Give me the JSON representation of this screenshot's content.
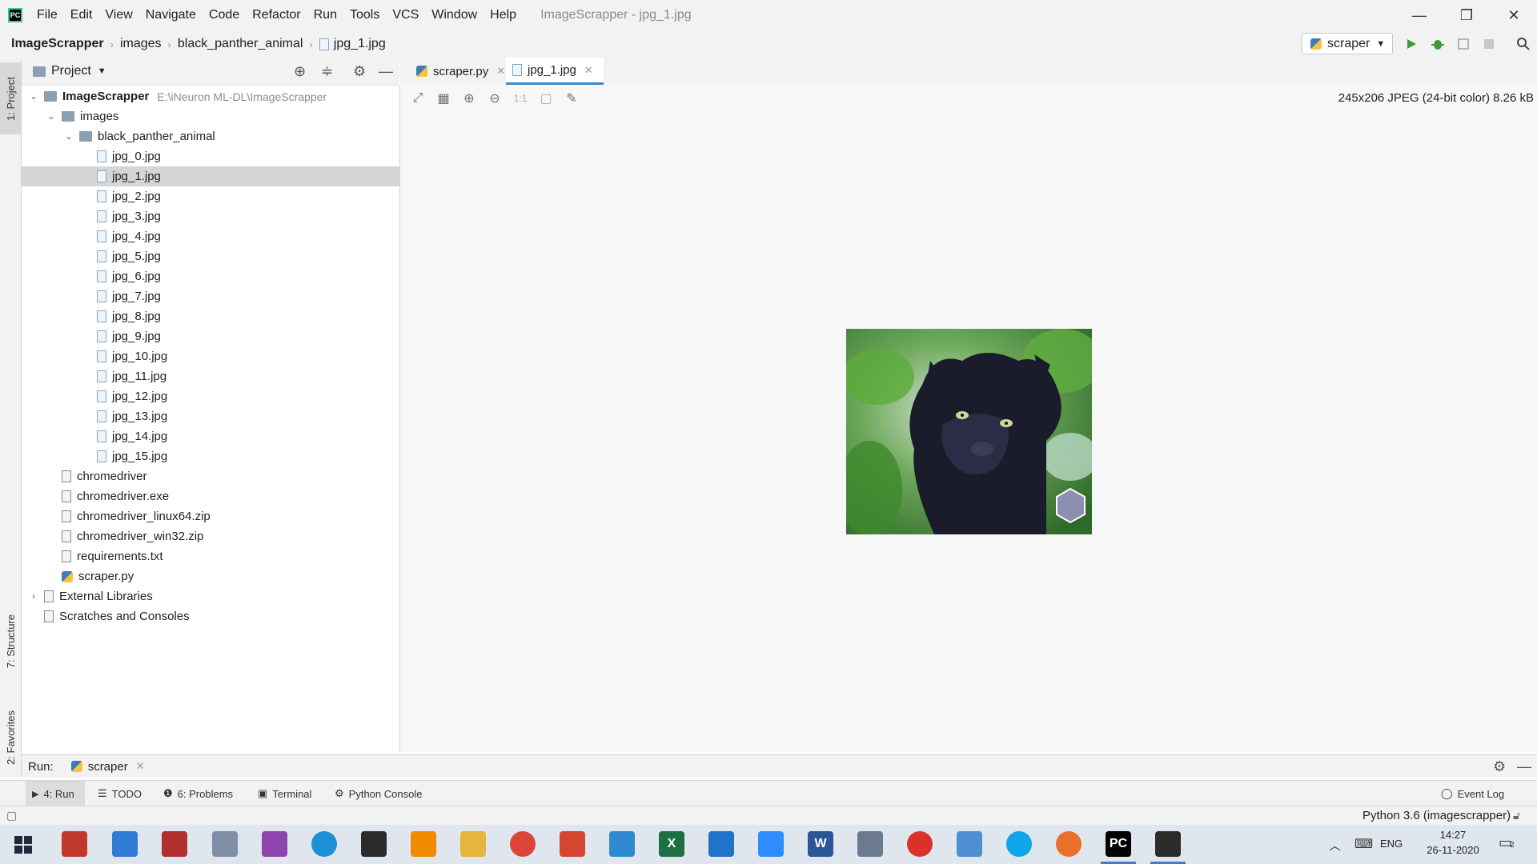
{
  "menu": {
    "logo": "PC",
    "items": [
      "File",
      "Edit",
      "View",
      "Navigate",
      "Code",
      "Refactor",
      "Run",
      "Tools",
      "VCS",
      "Window",
      "Help"
    ],
    "window_title": "ImageScrapper - jpg_1.jpg"
  },
  "window_controls": {
    "minimize": "—",
    "restore": "❐",
    "close": "✕"
  },
  "breadcrumb": [
    "ImageScrapper",
    "images",
    "black_panther_animal",
    "jpg_1.jpg"
  ],
  "run_config": {
    "label": "scraper"
  },
  "left_strip": {
    "project": "1: Project",
    "structure": "7: Structure",
    "favorites": "2: Favorites"
  },
  "project_panel": {
    "title": "Project",
    "tree": [
      {
        "label": "ImageScrapper",
        "detail": "E:\\iNeuron ML-DL\\ImageScrapper",
        "type": "folder",
        "depth": 0,
        "expanded": true
      },
      {
        "label": "images",
        "type": "folder",
        "depth": 1,
        "expanded": true
      },
      {
        "label": "black_panther_animal",
        "type": "folder",
        "depth": 2,
        "expanded": true
      },
      {
        "label": "jpg_0.jpg",
        "type": "image",
        "depth": 3
      },
      {
        "label": "jpg_1.jpg",
        "type": "image",
        "depth": 3,
        "selected": true
      },
      {
        "label": "jpg_2.jpg",
        "type": "image",
        "depth": 3
      },
      {
        "label": "jpg_3.jpg",
        "type": "image",
        "depth": 3
      },
      {
        "label": "jpg_4.jpg",
        "type": "image",
        "depth": 3
      },
      {
        "label": "jpg_5.jpg",
        "type": "image",
        "depth": 3
      },
      {
        "label": "jpg_6.jpg",
        "type": "image",
        "depth": 3
      },
      {
        "label": "jpg_7.jpg",
        "type": "image",
        "depth": 3
      },
      {
        "label": "jpg_8.jpg",
        "type": "image",
        "depth": 3
      },
      {
        "label": "jpg_9.jpg",
        "type": "image",
        "depth": 3
      },
      {
        "label": "jpg_10.jpg",
        "type": "image",
        "depth": 3
      },
      {
        "label": "jpg_11.jpg",
        "type": "image",
        "depth": 3
      },
      {
        "label": "jpg_12.jpg",
        "type": "image",
        "depth": 3
      },
      {
        "label": "jpg_13.jpg",
        "type": "image",
        "depth": 3
      },
      {
        "label": "jpg_14.jpg",
        "type": "image",
        "depth": 3
      },
      {
        "label": "jpg_15.jpg",
        "type": "image",
        "depth": 3
      },
      {
        "label": "chromedriver",
        "type": "generic",
        "depth": 1
      },
      {
        "label": "chromedriver.exe",
        "type": "generic",
        "depth": 1
      },
      {
        "label": "chromedriver_linux64.zip",
        "type": "generic",
        "depth": 1
      },
      {
        "label": "chromedriver_win32.zip",
        "type": "generic",
        "depth": 1
      },
      {
        "label": "requirements.txt",
        "type": "generic",
        "depth": 1
      },
      {
        "label": "scraper.py",
        "type": "python",
        "depth": 1
      },
      {
        "label": "External Libraries",
        "type": "libraries",
        "depth": 0,
        "expanded": false
      },
      {
        "label": "Scratches and Consoles",
        "type": "scratches",
        "depth": 0
      }
    ]
  },
  "editor_tabs": [
    {
      "label": "scraper.py",
      "active": false
    },
    {
      "label": "jpg_1.jpg",
      "active": true
    }
  ],
  "image_viewer": {
    "info": "245x206 JPEG (24-bit color) 8.26 kB",
    "tools": [
      "fit-icon",
      "grid-icon",
      "zoom-in-icon",
      "zoom-out-icon",
      "actual-size-icon",
      "background-icon",
      "color-picker-icon"
    ],
    "actual_size_label": "1:1"
  },
  "run_bar": {
    "label": "Run:",
    "config": "scraper"
  },
  "bottom_tabs": [
    "4: Run",
    "TODO",
    "6: Problems",
    "Terminal",
    "Python Console"
  ],
  "event_log": "Event Log",
  "status": {
    "interpreter": "Python 3.6 (imagescrapper)"
  },
  "taskbar": {
    "time": "14:27",
    "date": "26-11-2020",
    "language": "ENG",
    "notification_count": "2",
    "apps": [
      {
        "name": "excel-icon",
        "label": "X",
        "color": "#1d7044"
      },
      {
        "name": "word-icon",
        "label": "W",
        "color": "#2b5797"
      },
      {
        "name": "pycharm-icon",
        "label": "PC",
        "color": "#000000"
      }
    ]
  }
}
